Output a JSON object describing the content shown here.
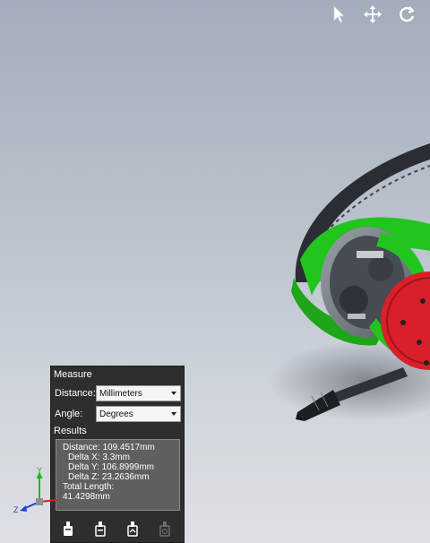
{
  "toolbar": {
    "icons": [
      "select-arrow-icon",
      "pan-icon",
      "rotate-icon"
    ]
  },
  "measure": {
    "title": "Measure",
    "distance_label": "Distance:",
    "distance_unit": "Millimeters",
    "angle_label": "Angle:",
    "angle_unit": "Degrees",
    "results_label": "Results",
    "results": {
      "distance": "Distance: 109.4517mm",
      "delta_x": "Delta X: 3.3mm",
      "delta_y": "Delta Y: 106.8999mm",
      "delta_z": "Delta Z: 23.2636mm",
      "total_length_label": "Total Length:",
      "total_length_value": "41.4298mm"
    },
    "buttons": [
      "point-to-point-icon",
      "min-distance-icon",
      "max-distance-icon",
      "measure-reset-icon"
    ]
  },
  "triad": {
    "y_label": "Y",
    "z_label": "Z"
  },
  "colors": {
    "panel_bg": "#2e2e2e",
    "results_bg": "#5f5f5f",
    "model_green": "#22c51e",
    "model_red": "#d9202a",
    "model_dark": "#2a2d33"
  }
}
